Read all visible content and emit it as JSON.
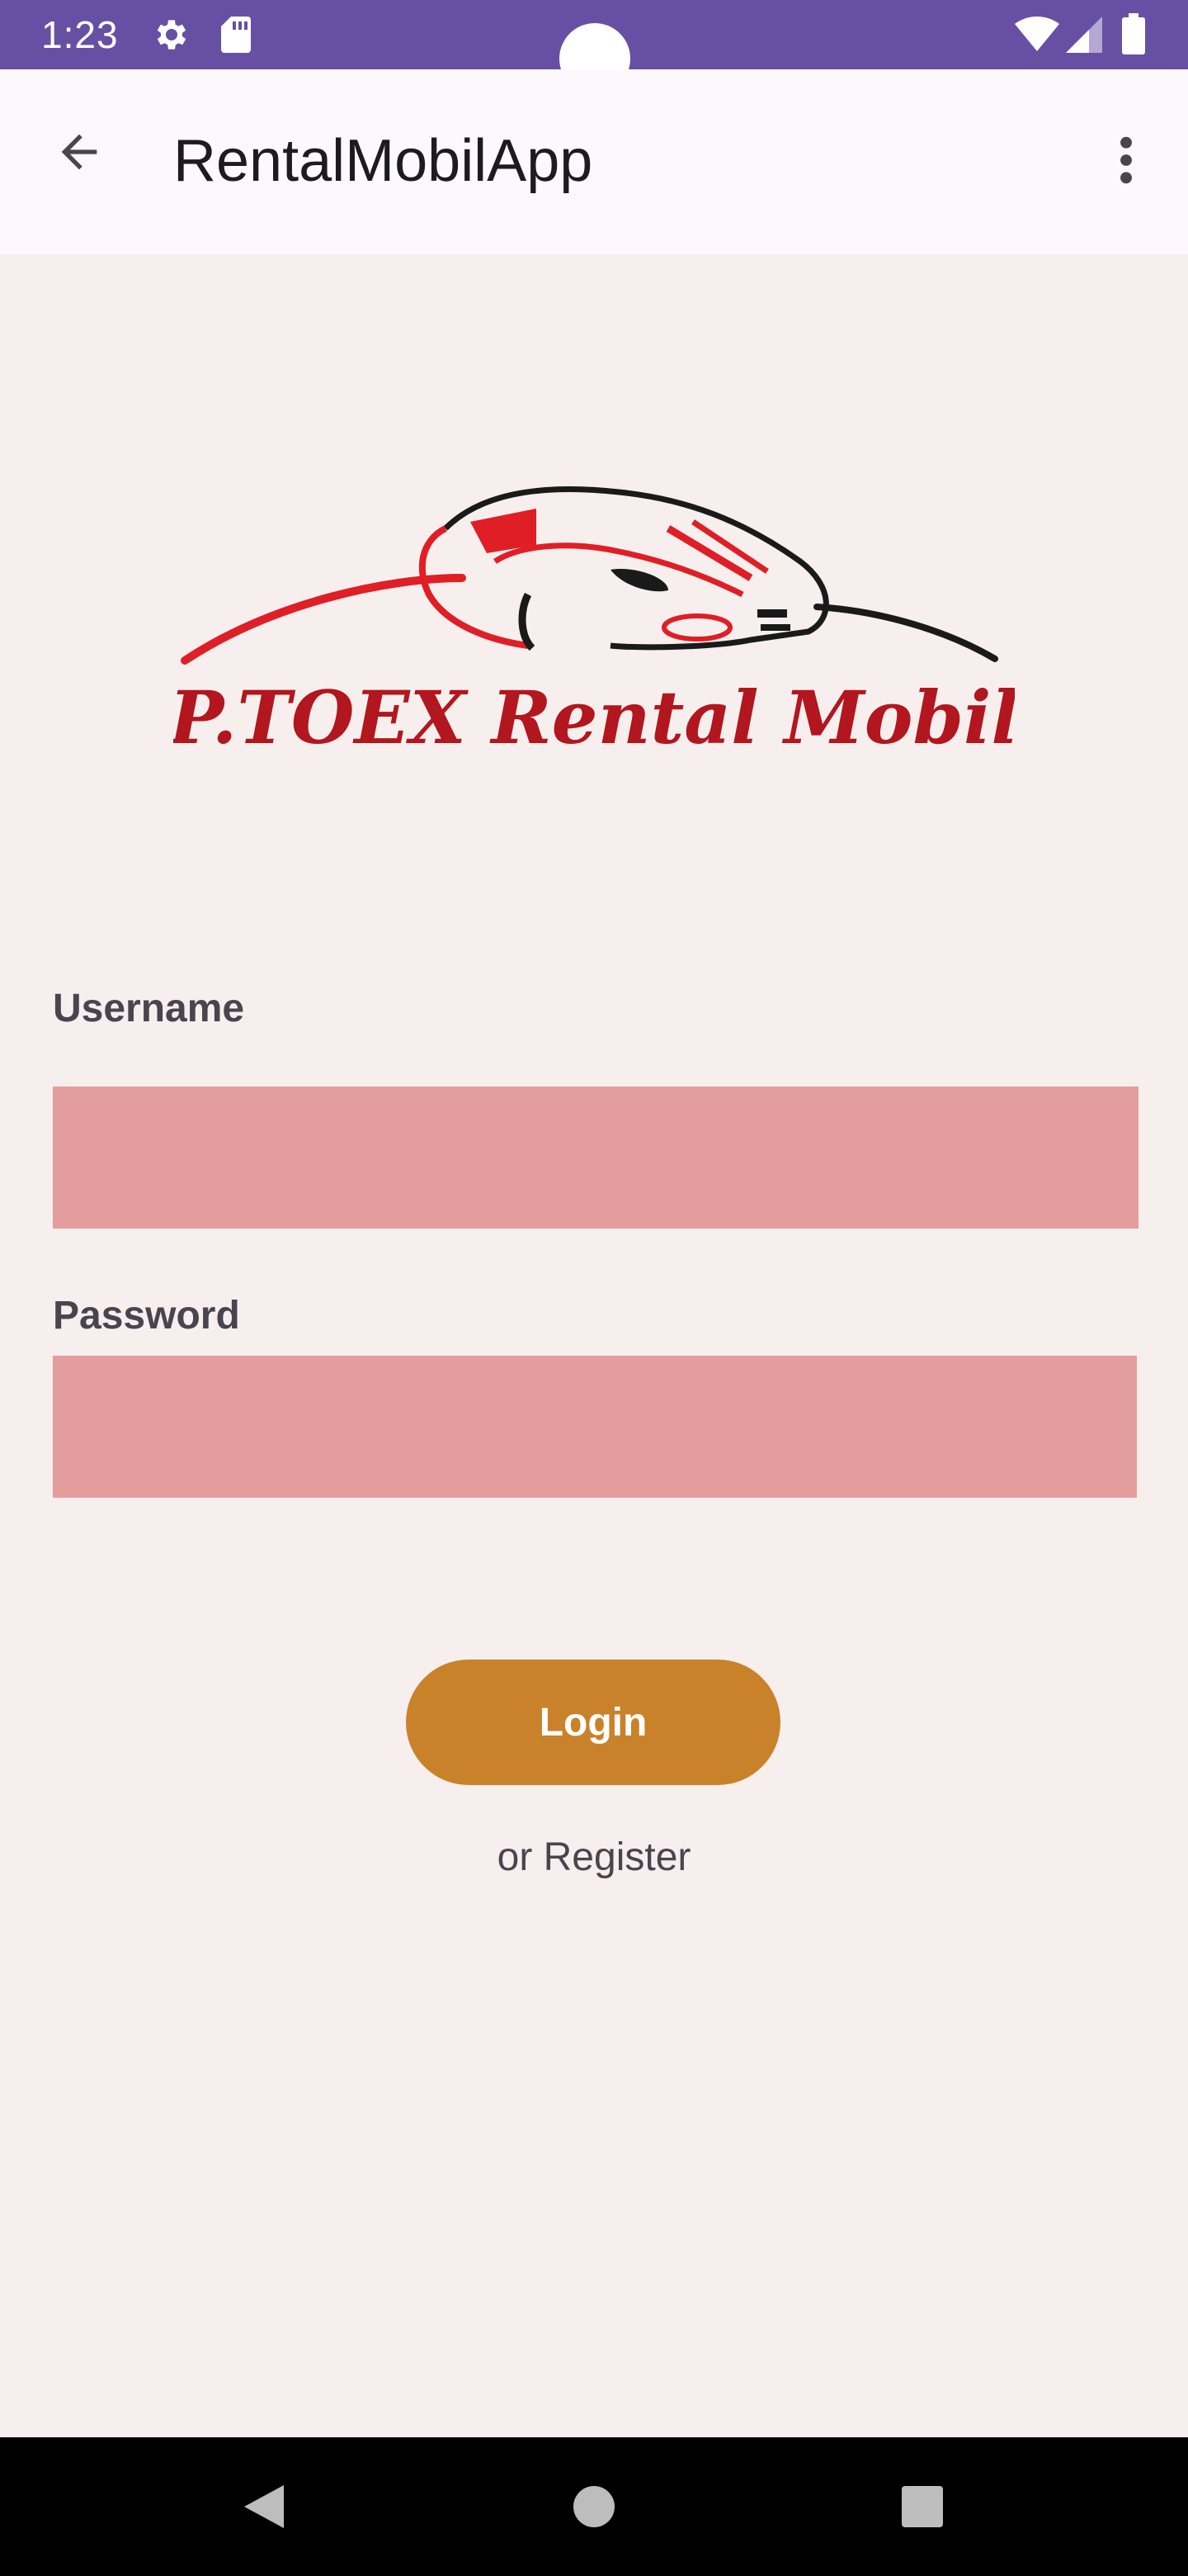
{
  "status_bar": {
    "time": "1:23",
    "icons": [
      "settings-gear-icon",
      "sd-card-icon",
      "wifi-icon",
      "cellular-signal-icon",
      "battery-icon"
    ],
    "color": "#6750a4"
  },
  "app_bar": {
    "title": "RentalMobilApp",
    "back_icon": "arrow-back-icon",
    "menu_icon": "more-vert-icon"
  },
  "logo": {
    "text": "P.TOEX Rental Mobil",
    "color": "#c8202b"
  },
  "form": {
    "username_label": "Username",
    "username_value": "",
    "password_label": "Password",
    "password_value": "",
    "field_color": "#e39d9d",
    "login_label": "Login",
    "login_color": "#c9822a",
    "register_text": "or Register"
  },
  "nav_bar": {
    "icons": [
      "nav-back-icon",
      "nav-home-icon",
      "nav-recents-icon"
    ]
  }
}
